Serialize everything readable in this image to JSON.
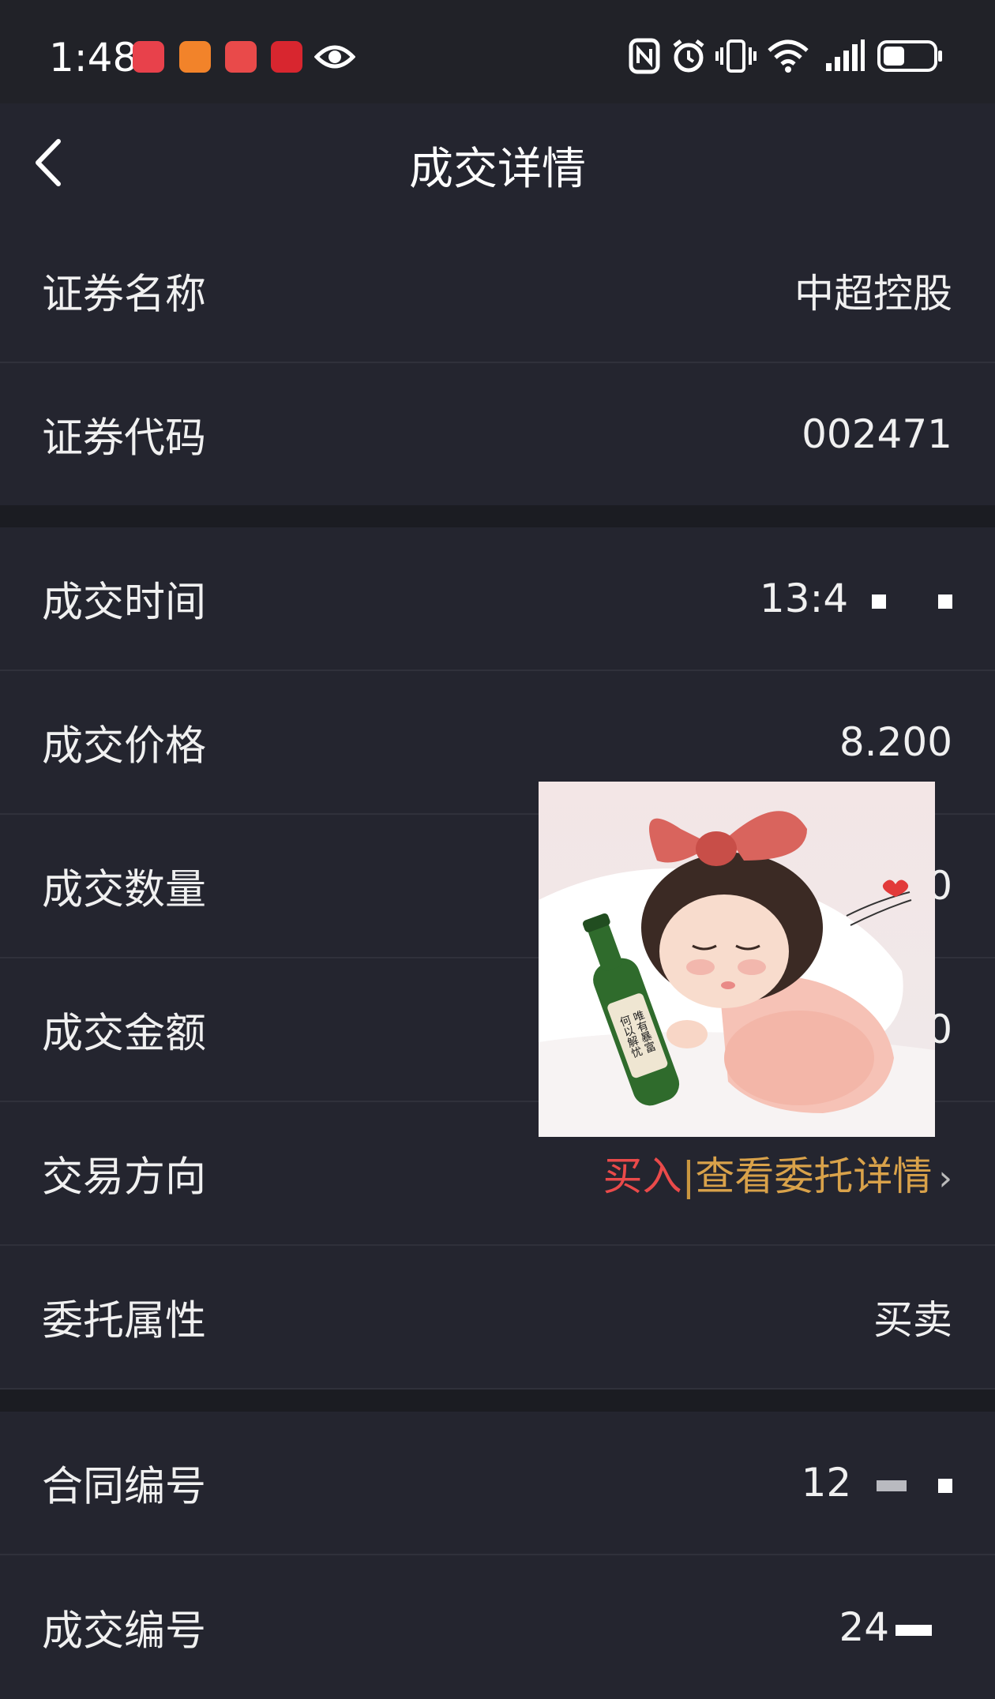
{
  "status_bar": {
    "time": "1:48",
    "icons": [
      "huawei-store-icon",
      "video-app-icon",
      "reader-app-icon",
      "taobao-app-icon",
      "eye-icon",
      "nfc-icon",
      "alarm-icon",
      "vibrate-icon",
      "wifi-icon",
      "signal-icon",
      "battery-icon"
    ]
  },
  "header": {
    "title": "成交详情",
    "back_icon": "chevron-left-icon"
  },
  "rows": [
    {
      "label": "证券名称",
      "value": "中超控股"
    },
    {
      "label": "证券代码",
      "value": "002471"
    },
    {
      "label": "成交时间",
      "value": "13:4"
    },
    {
      "label": "成交价格",
      "value": "8.200"
    },
    {
      "label": "成交数量",
      "value": "0"
    },
    {
      "label": "成交金额",
      "value": "0"
    },
    {
      "label": "交易方向",
      "direction": "买入",
      "separator": "|",
      "link": "查看委托详情"
    },
    {
      "label": "委托属性",
      "value": "买卖"
    },
    {
      "label": "合同编号",
      "value": "12"
    },
    {
      "label": "成交编号",
      "value": "24"
    }
  ],
  "sticker": {
    "bottle_text": "何以解忧 唯有暴富"
  },
  "colors": {
    "background": "#24252f",
    "buy": "#ea4a4a",
    "link": "#d9a24a"
  }
}
